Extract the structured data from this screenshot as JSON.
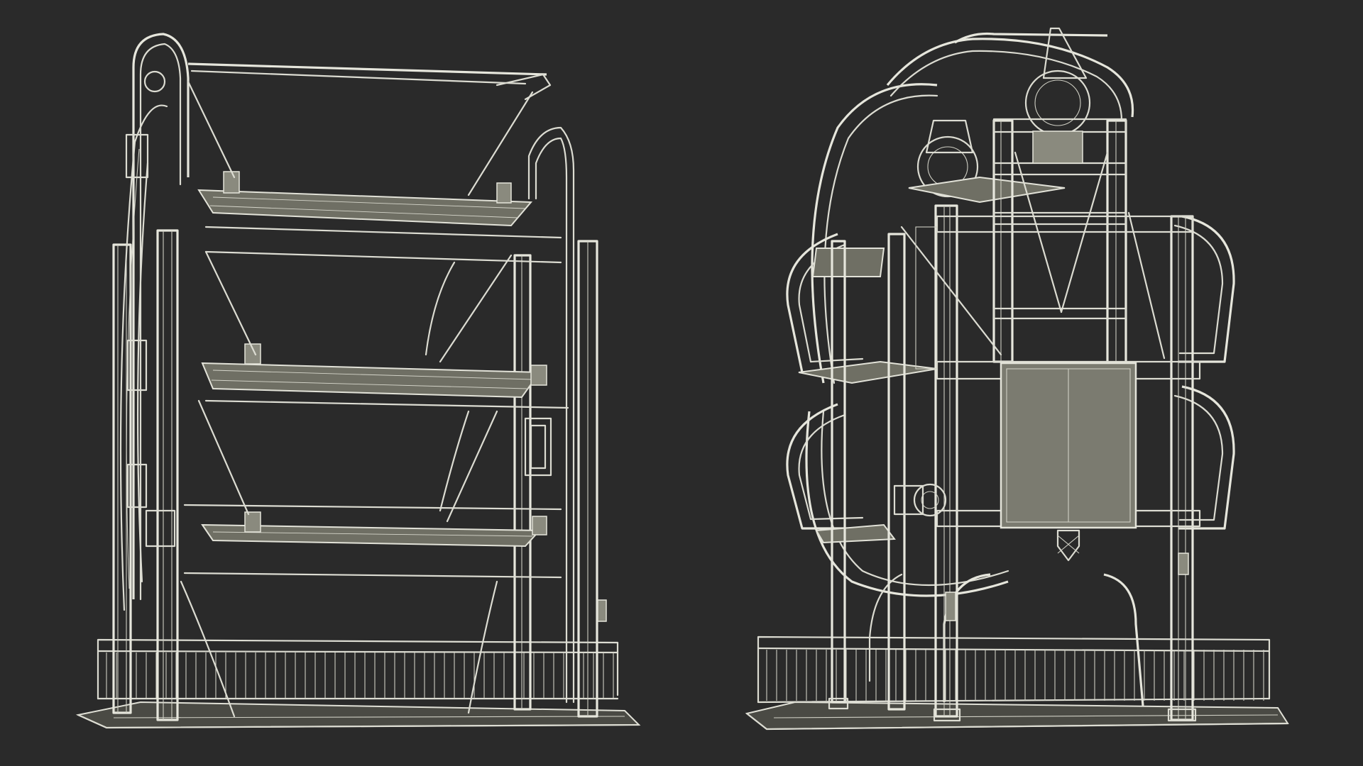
{
  "scene": {
    "background_color": "#2a2a2a",
    "wire_color": "#dcdcd2",
    "fill_color": "#6f6f64",
    "models": [
      {
        "id": "model-front-oblique",
        "icon": "rotary-parking-tower-wireframe"
      },
      {
        "id": "model-side-oblique",
        "icon": "rotary-parking-tower-wireframe"
      }
    ]
  }
}
